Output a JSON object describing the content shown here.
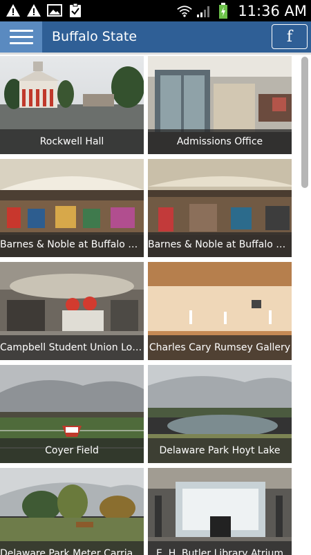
{
  "status_bar": {
    "time": "11:36 AM",
    "icons": [
      "warning-icon",
      "warning-icon",
      "image-icon",
      "clipboard-check-icon",
      "wifi-icon",
      "signal-icon",
      "battery-charging-icon"
    ]
  },
  "app_bar": {
    "title": "Buffalo State",
    "menu_icon": "hamburger-menu-icon",
    "facebook_label": "f"
  },
  "tiles": [
    {
      "label": "Rockwell Hall",
      "scene": "building"
    },
    {
      "label": "Admissions Office",
      "scene": "interior"
    },
    {
      "label": "Barnes & Noble at Buffalo State",
      "scene": "store"
    },
    {
      "label": "Barnes & Noble at Buffalo State",
      "scene": "store"
    },
    {
      "label": "Campbell Student Union Lobby",
      "scene": "lobby"
    },
    {
      "label": "Charles Cary Rumsey Gallery",
      "scene": "gallery"
    },
    {
      "label": "Coyer Field",
      "scene": "field"
    },
    {
      "label": "Delaware Park Hoyt Lake",
      "scene": "lake"
    },
    {
      "label": "Delaware Park Meter Carriage",
      "scene": "park"
    },
    {
      "label": "E. H. Butler Library Atrium",
      "scene": "atrium"
    }
  ],
  "colors": {
    "app_bar": "#2f5f96",
    "menu_button": "#5a8ac0",
    "status_bar": "#000000",
    "caption_overlay": "rgba(40,40,40,0.75)"
  }
}
